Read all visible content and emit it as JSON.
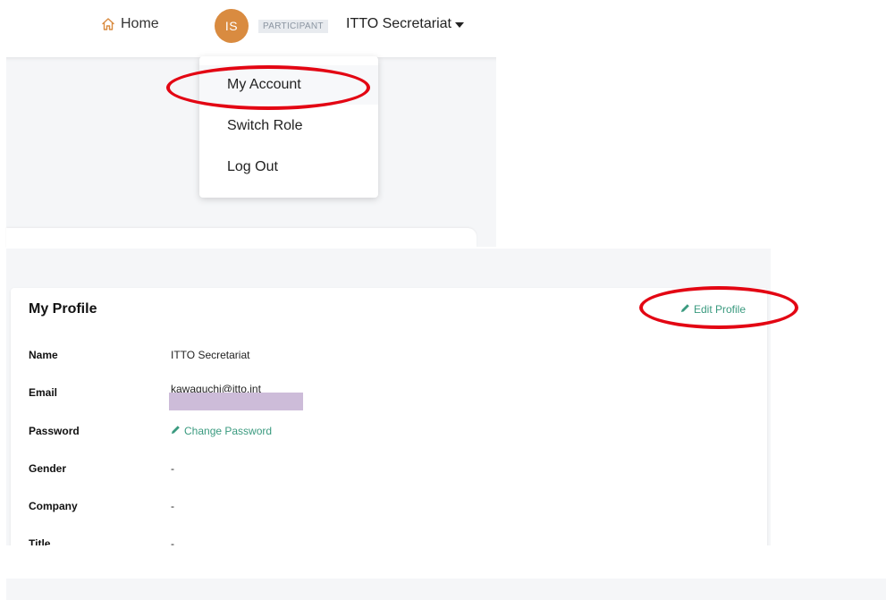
{
  "nav": {
    "home_label": "Home",
    "avatar_initials": "IS",
    "role_badge": "PARTICIPANT",
    "user_name": "ITTO Secretariat"
  },
  "dropdown": {
    "items": [
      "My Account",
      "Switch Role",
      "Log Out"
    ]
  },
  "profile": {
    "title": "My Profile",
    "edit_label": "Edit Profile",
    "fields": [
      {
        "label": "Name",
        "value": "ITTO Secretariat"
      },
      {
        "label": "Email",
        "value": "kawaguchi@itto.int"
      },
      {
        "label": "Password",
        "value": "Change Password"
      },
      {
        "label": "Gender",
        "value": "-"
      },
      {
        "label": "Company",
        "value": "-"
      },
      {
        "label": "Title",
        "value": "-"
      }
    ]
  },
  "colors": {
    "avatar": "#d98b40",
    "accent_green": "#3a9a7f",
    "highlight_red": "#e30613",
    "redaction": "#cdbcd9",
    "panel_bg": "#f5f6f8"
  },
  "icons": [
    "home-icon",
    "caret-down-icon",
    "pencil-icon"
  ]
}
